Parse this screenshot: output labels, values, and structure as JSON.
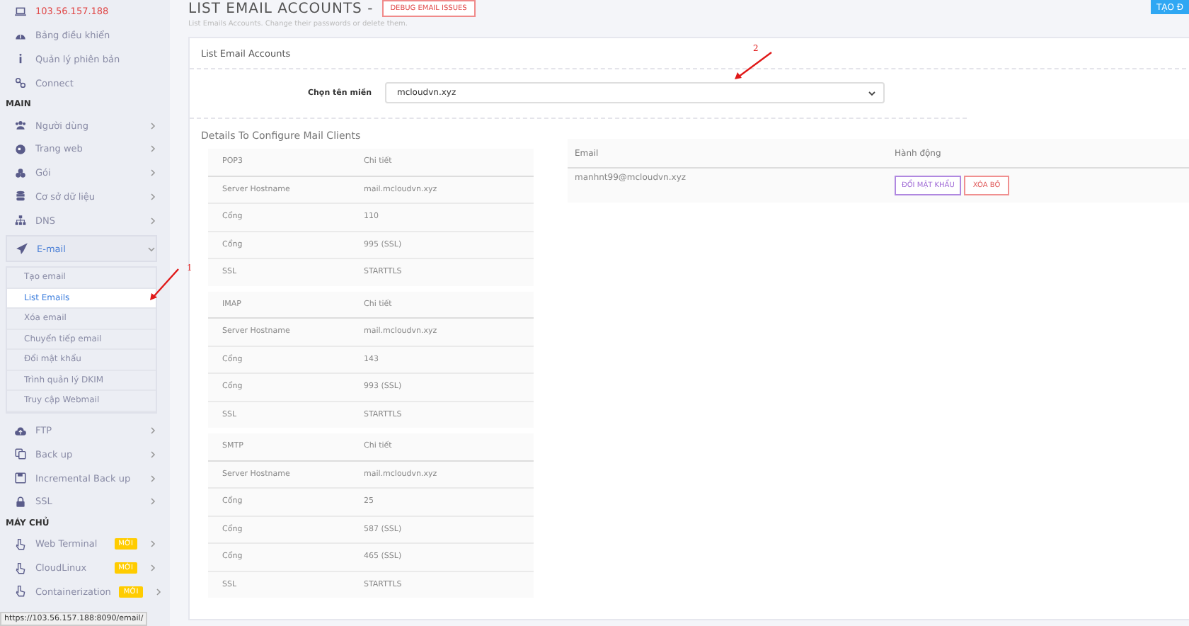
{
  "sidebar": {
    "items": [
      {
        "kind": "host",
        "label": "103.56.157.188"
      },
      {
        "kind": "link",
        "label": "Bảng điều khiển",
        "arrow": false
      },
      {
        "kind": "link",
        "label": "Quản lý phiên bản",
        "arrow": false
      },
      {
        "kind": "link",
        "label": "Connect",
        "arrow": false
      },
      {
        "kind": "heading",
        "label": "MAIN"
      },
      {
        "kind": "link",
        "label": "Người dùng",
        "arrow": true
      },
      {
        "kind": "link",
        "label": "Trang web",
        "arrow": true
      },
      {
        "kind": "link",
        "label": "Gói",
        "arrow": true
      },
      {
        "kind": "link",
        "label": "Cơ sở dữ liệu",
        "arrow": true
      },
      {
        "kind": "link",
        "label": "DNS",
        "arrow": true
      },
      {
        "kind": "menu",
        "label": "E-mail",
        "expanded": true,
        "children": [
          {
            "label": "Tạo email",
            "selected": false
          },
          {
            "label": "List Emails",
            "selected": true
          },
          {
            "label": "Xóa email",
            "selected": false
          },
          {
            "label": "Chuyển tiếp email",
            "selected": false
          },
          {
            "label": "Đổi mật khẩu",
            "selected": false
          },
          {
            "label": "Trình quản lý DKIM",
            "selected": false
          },
          {
            "label": "Truy cập Webmail",
            "selected": false
          }
        ]
      },
      {
        "kind": "link",
        "label": "FTP",
        "arrow": true
      },
      {
        "kind": "link",
        "label": "Back up",
        "arrow": true
      },
      {
        "kind": "link",
        "label": "Incremental Back up",
        "arrow": true
      },
      {
        "kind": "link",
        "label": "SSL",
        "arrow": true
      },
      {
        "kind": "heading",
        "label": "MÁY CHỦ"
      },
      {
        "kind": "link",
        "label": "Web Terminal",
        "arrow": true,
        "badge": "MỚI"
      },
      {
        "kind": "link",
        "label": "CloudLinux",
        "arrow": true,
        "badge": "MỚI"
      },
      {
        "kind": "link",
        "label": "Containerization",
        "arrow": true,
        "badge": "MỚI"
      }
    ]
  },
  "header": {
    "title": "LIST EMAIL ACCOUNTS - ",
    "debug_button": "DEBUG EMAIL ISSUES",
    "subtitle": "List Emails Accounts. Change their passwords or delete them.",
    "create_button": "TẠO Đ"
  },
  "card": {
    "title": "List Email Accounts",
    "domain_label": "Chọn tên miền",
    "domain_value": "mcloudvn.xyz",
    "details_title": "Details To Configure Mail Clients",
    "protocols": [
      {
        "columns": [
          "POP3",
          "Chi tiết"
        ],
        "rows": [
          [
            "Server Hostname",
            "mail.mcloudvn.xyz"
          ],
          [
            "Cổng",
            "110"
          ],
          [
            "Cổng",
            "995 (SSL)"
          ],
          [
            "SSL",
            "STARTTLS"
          ]
        ]
      },
      {
        "columns": [
          "IMAP",
          "Chi tiết"
        ],
        "rows": [
          [
            "Server Hostname",
            "mail.mcloudvn.xyz"
          ],
          [
            "Cổng",
            "143"
          ],
          [
            "Cổng",
            "993 (SSL)"
          ],
          [
            "SSL",
            "STARTTLS"
          ]
        ]
      },
      {
        "columns": [
          "SMTP",
          "Chi tiết"
        ],
        "rows": [
          [
            "Server Hostname",
            "mail.mcloudvn.xyz"
          ],
          [
            "Cổng",
            "25"
          ],
          [
            "Cổng",
            "587 (SSL)"
          ],
          [
            "Cổng",
            "465 (SSL)"
          ],
          [
            "SSL",
            "STARTTLS"
          ]
        ]
      }
    ],
    "accounts": {
      "columns": [
        "Email",
        "Hành động"
      ],
      "rows": [
        {
          "email": "manhnt99@mcloudvn.xyz",
          "change_button": "ĐỔI MẬT KHẨU",
          "delete_button": "XÓA BỎ"
        }
      ]
    }
  },
  "annotations": [
    {
      "label": "1"
    },
    {
      "label": "2"
    }
  ],
  "status_url": "https://103.56.157.188:8090/email/"
}
